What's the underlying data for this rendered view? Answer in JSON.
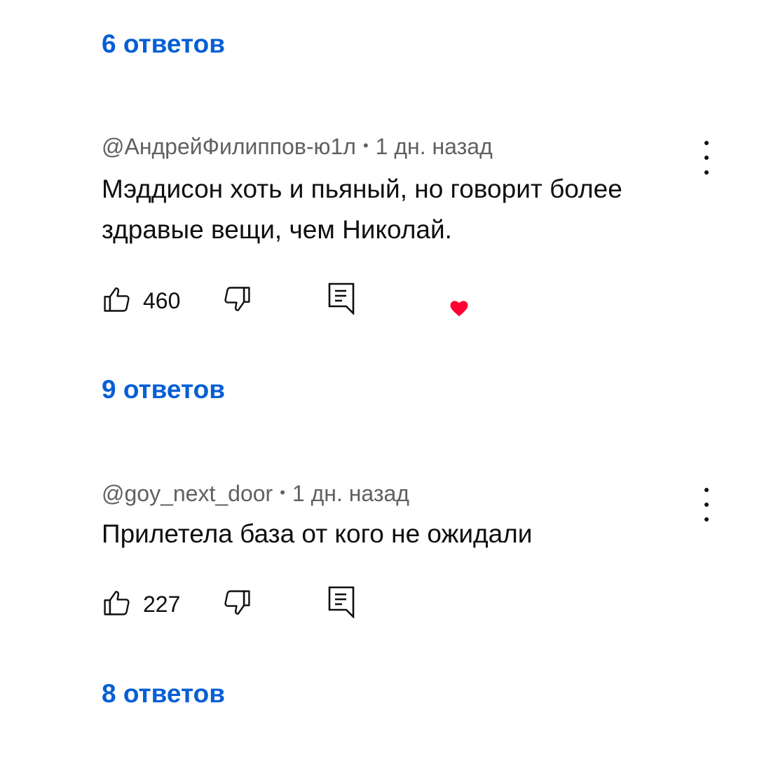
{
  "replies_top": {
    "label": "6 ответов"
  },
  "comments": [
    {
      "author": "@АндрейФилиппов-ю1л",
      "separator": "•",
      "time": "1 дн. назад",
      "text": "Мэддисон хоть и пьяный, но говорит более здравые вещи, чем Николай.",
      "likes": "460",
      "creator_heart": true,
      "replies_label": "9 ответов"
    },
    {
      "author": "@goy_next_door",
      "separator": "•",
      "time": "1 дн. назад",
      "text": "Прилетела база от кого не ожидали",
      "likes": "227",
      "creator_heart": false,
      "replies_label": "8 ответов"
    }
  ],
  "icons": {
    "like": "thumb-up-icon",
    "dislike": "thumb-down-icon",
    "reply": "reply-comment-icon",
    "menu": "more-vertical-icon",
    "heart": "creator-heart-icon"
  },
  "colors": {
    "link": "#065fd4",
    "meta": "#606060",
    "text": "#0f0f0f",
    "heart": "#ff0033"
  }
}
